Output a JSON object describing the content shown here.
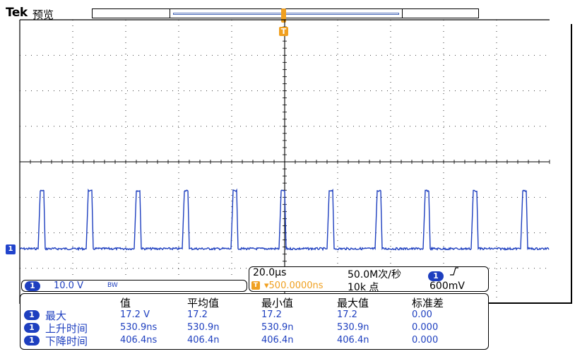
{
  "header": {
    "brand": "Tek",
    "mode": "预览"
  },
  "markers": {
    "trigger_marker": "T",
    "channel_ground_marker": "1"
  },
  "colors": {
    "trace": "#1e3fbf",
    "trigger": "#f0a020",
    "grid": "#000000"
  },
  "channel": {
    "number": "1",
    "scale": "10.0 V",
    "bandwidth_limit": "BW"
  },
  "timebase": {
    "horizontal_scale": "20.0μs",
    "sample_rate": "50.0M次/秒",
    "trigger_position": "▾500.0000ns",
    "trigger_icon": "T",
    "record_length": "10k 点",
    "trigger_channel": "1",
    "trigger_slope": "⎍",
    "trigger_level": "600mV"
  },
  "measurements": {
    "headers": [
      "值",
      "平均值",
      "最小值",
      "最大值",
      "标准差"
    ],
    "rows": [
      {
        "channel": "1",
        "name": "最大",
        "value": "17.2 V",
        "mean": "17.2",
        "min": "17.2",
        "max": "17.2",
        "std": "0.00"
      },
      {
        "channel": "1",
        "name": "上升时间",
        "value": "530.9ns",
        "mean": "530.9n",
        "min": "530.9n",
        "max": "530.9n",
        "std": "0.000"
      },
      {
        "channel": "1",
        "name": "下降时间",
        "value": "406.4ns",
        "mean": "406.4n",
        "min": "406.4n",
        "max": "406.4n",
        "std": "0.000"
      }
    ]
  }
}
